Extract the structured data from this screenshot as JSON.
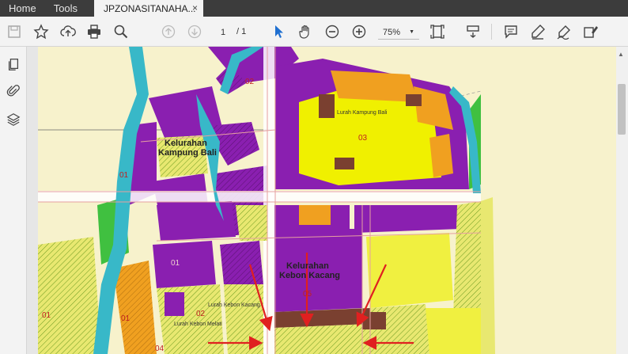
{
  "tabbar": {
    "home": "Home",
    "tools": "Tools",
    "document_tab": "JPZONASITANAHA...",
    "close_symbol": "×"
  },
  "toolbar": {
    "page_current": "1",
    "page_total": "/ 1",
    "zoom": "75%"
  },
  "map": {
    "labels": {
      "kampung_bali": "Kelurahan\nKampung Bali",
      "kampung_bali_l1": "Kelurahan",
      "kampung_bali_l2": "Kampung Bali",
      "kebon_kacang_l1": "Kelurahan",
      "kebon_kacang_l2": "Kebon Kacang",
      "lurah_kampung_bali": "Lurah Kampung Bali",
      "lurah_kebon_kacang": "Lurah Kebon Kacang",
      "lurah_kebon_melati": "Lurah Kebon Melati",
      "block_02": "02",
      "block_03": "03",
      "block_01a": "01",
      "block_01b": "01",
      "block_01c": "01",
      "block_01d": "01",
      "block_02b": "02",
      "block_05": "05",
      "block_04": "04"
    },
    "colors": {
      "background": "#f5f0c8",
      "purple": "#8a1fb0",
      "yellow": "#f0f000",
      "orange": "#f0a020",
      "brown": "#7a4030",
      "light_yellow_hatch": "#d8e060",
      "green": "#40c040",
      "river": "#38b8c8",
      "road": "#ffffff",
      "arrow": "#e02020"
    }
  }
}
